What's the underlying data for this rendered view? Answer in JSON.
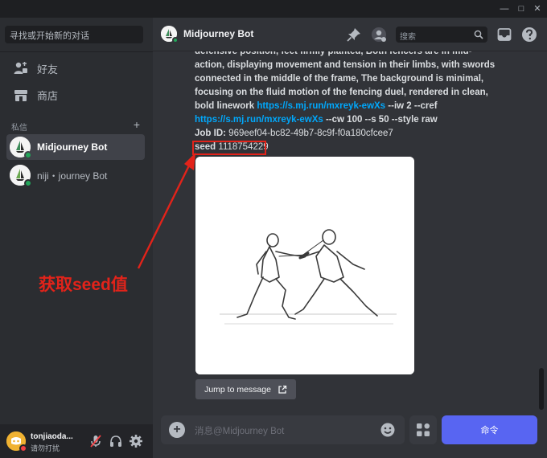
{
  "sidebar": {
    "search_placeholder": "寻找或开始新的对话",
    "nav": [
      {
        "label": "好友",
        "icon": "friends-icon"
      },
      {
        "label": "商店",
        "icon": "shop-icon"
      }
    ],
    "dm_header": "私信",
    "dm_plus": "+",
    "dms": [
      {
        "label": "Midjourney Bot",
        "active": true
      },
      {
        "label": "niji・journey Bot",
        "active": false
      }
    ]
  },
  "user": {
    "name": "tonjiaoda...",
    "status": "请勿打扰"
  },
  "topbar": {
    "title": "Midjourney Bot",
    "search_placeholder": "搜索"
  },
  "message": {
    "line1": "defensive position, feet firmly planted, Both fencers are in mid-",
    "line2": "action, displaying movement and tension in their limbs, with swords",
    "line3": "connected in the middle of the frame, The background is minimal,",
    "line4": "focusing on the fluid motion of the fencing duel, rendered in clean,",
    "line5_text": "bold linework ",
    "link1": "https://s.mj.run/mxreyk-ewXs",
    "line5_tail": " --iw 2 --cref",
    "link2": "https://s.mj.run/mxreyk-ewXs",
    "line6_tail": " --cw 100 --s 50 --style raw",
    "job_label": "Job ID:",
    "job_value": " 969eef04-bc82-49b7-8c9f-f0a180cfcee7",
    "seed_label": "seed",
    "seed_value": " 1118754229",
    "jump_label": "Jump to message"
  },
  "input": {
    "placeholder": "消息@Midjourney Bot",
    "command_label": "命令"
  },
  "annotation": {
    "label": "获取seed值",
    "color": "#e2231a"
  },
  "colors": {
    "accent": "#5865f2",
    "link": "#00a8fc",
    "online": "#23a55a",
    "dnd": "#f23f43"
  }
}
